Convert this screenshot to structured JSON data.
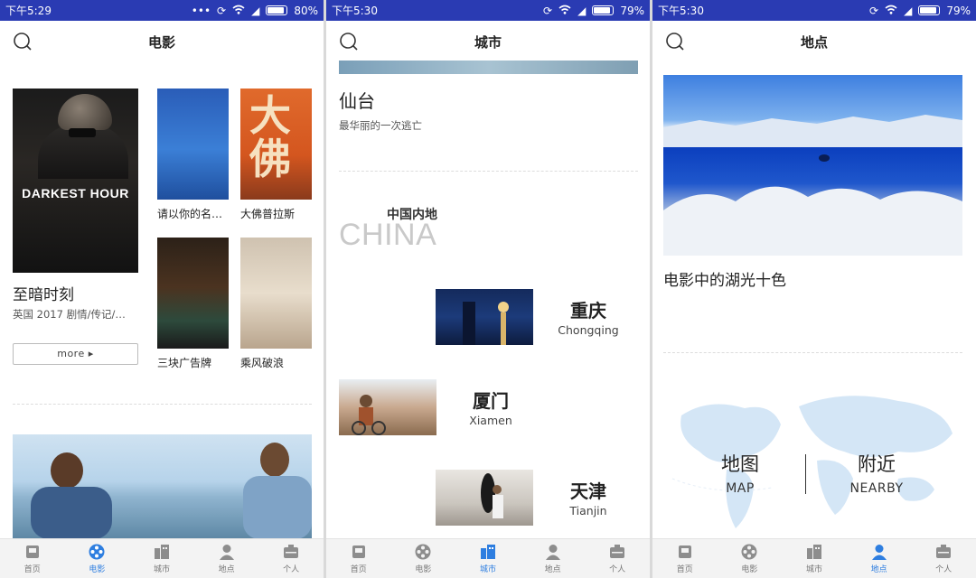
{
  "screens": [
    {
      "status": {
        "time": "下午5:29",
        "battery": "80%",
        "battery_level": 0.8,
        "dots": "•••"
      },
      "title": "电影",
      "featured": {
        "poster_text": "DARKEST HOUR",
        "title": "至暗时刻",
        "meta": "英国 2017 剧情/传记/…",
        "more_label": "more ▸"
      },
      "grid": [
        {
          "caption": "请以你的名…"
        },
        {
          "caption": "大佛普拉斯",
          "poster_text": "大佛"
        },
        {
          "caption": "三块广告牌"
        },
        {
          "caption": "乘风破浪"
        }
      ]
    },
    {
      "status": {
        "time": "下午5:30",
        "battery": "79%",
        "battery_level": 0.79
      },
      "title": "城市",
      "top_city": {
        "name": "仙台",
        "desc": "最华丽的一次逃亡"
      },
      "section": {
        "cn": "中国内地",
        "en": "CHINA"
      },
      "cities": [
        {
          "cn": "重庆",
          "en": "Chongqing"
        },
        {
          "cn": "厦门",
          "en": "Xiamen"
        },
        {
          "cn": "天津",
          "en": "Tianjin"
        }
      ]
    },
    {
      "status": {
        "time": "下午5:30",
        "battery": "79%",
        "battery_level": 0.79
      },
      "title": "地点",
      "feature": {
        "title": "电影中的湖光十色"
      },
      "map": {
        "left_cn": "地图",
        "left_en": "MAP",
        "right_cn": "附近",
        "right_en": "NEARBY"
      }
    }
  ],
  "tabs": [
    {
      "label": "首页",
      "icon": "home-icon"
    },
    {
      "label": "电影",
      "icon": "film-reel-icon"
    },
    {
      "label": "城市",
      "icon": "city-icon"
    },
    {
      "label": "地点",
      "icon": "location-person-icon"
    },
    {
      "label": "个人",
      "icon": "profile-icon"
    }
  ],
  "active_tab": [
    "电影",
    "城市",
    "地点"
  ],
  "colors": {
    "status_bar": "#2a3bb3",
    "accent": "#2e7ee0",
    "tab_inactive": "#777777"
  }
}
